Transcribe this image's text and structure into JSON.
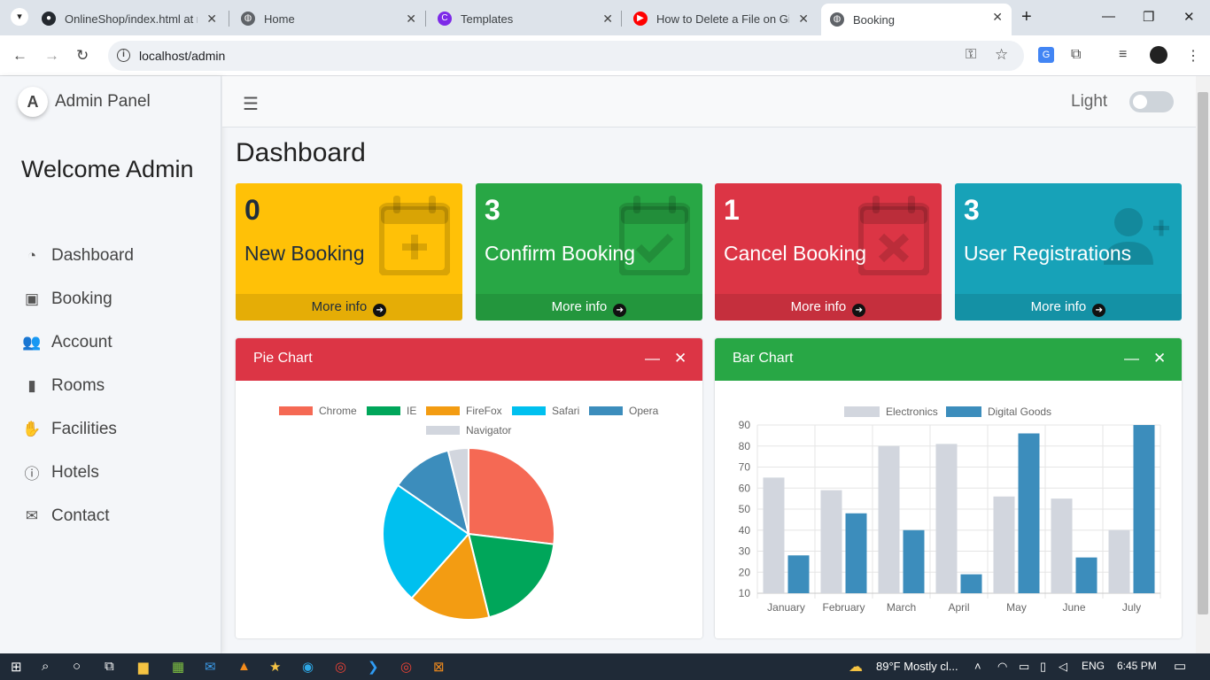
{
  "browser": {
    "tabs": [
      {
        "label": "OnlineShop/index.html at m",
        "icon": "github-icon",
        "color": "#24292f"
      },
      {
        "label": "Home",
        "icon": "globe-icon",
        "color": "#5f6368"
      },
      {
        "label": "Templates",
        "icon": "canva-icon",
        "color": "#7d2ae8"
      },
      {
        "label": "How to Delete a File on GitH",
        "icon": "youtube-icon",
        "color": "#ff0000"
      },
      {
        "label": "Booking",
        "icon": "globe-icon",
        "color": "#5f6368",
        "active": true
      }
    ],
    "url": "localhost/admin"
  },
  "sidebar": {
    "brand": "Admin Panel",
    "logo_letter": "A",
    "welcome": "Welcome Admin",
    "items": [
      {
        "label": "Dashboard",
        "icon": "tachometer-icon"
      },
      {
        "label": "Booking",
        "icon": "calendar-check-icon"
      },
      {
        "label": "Account",
        "icon": "users-icon"
      },
      {
        "label": "Rooms",
        "icon": "door-icon"
      },
      {
        "label": "Facilities",
        "icon": "handshake-icon"
      },
      {
        "label": "Hotels",
        "icon": "info-icon"
      },
      {
        "label": "Contact",
        "icon": "envelope-open-icon"
      }
    ]
  },
  "topbar": {
    "theme_label": "Light"
  },
  "page": {
    "title": "Dashboard"
  },
  "stats": [
    {
      "value": "0",
      "label": "New Booking",
      "more": "More info",
      "color": "#ffc107",
      "text_color": "#1f2d3d",
      "icon": "calendar-plus-icon"
    },
    {
      "value": "3",
      "label": "Confirm Booking",
      "more": "More info",
      "color": "#28a745",
      "text_color": "#ffffff",
      "icon": "calendar-check-icon"
    },
    {
      "value": "1",
      "label": "Cancel Booking",
      "more": "More info",
      "color": "#dc3545",
      "text_color": "#ffffff",
      "icon": "calendar-times-icon"
    },
    {
      "value": "3",
      "label": "User Registrations",
      "more": "More info",
      "color": "#17a2b8",
      "text_color": "#ffffff",
      "icon": "user-plus-icon"
    }
  ],
  "pie_card": {
    "title": "Pie Chart",
    "color": "#dc3545"
  },
  "bar_card": {
    "title": "Bar Chart",
    "color": "#28a745"
  },
  "chart_data": [
    {
      "type": "pie",
      "title": "",
      "categories": [
        "Chrome",
        "IE",
        "FireFox",
        "Safari",
        "Opera",
        "Navigator"
      ],
      "values": [
        700,
        500,
        400,
        600,
        300,
        100
      ],
      "colors": [
        "#f56954",
        "#00a65a",
        "#f39c12",
        "#00c0ef",
        "#3c8dbc",
        "#d2d6de"
      ],
      "legend": "top"
    },
    {
      "type": "bar",
      "title": "",
      "categories": [
        "January",
        "February",
        "March",
        "April",
        "May",
        "June",
        "July"
      ],
      "series": [
        {
          "name": "Electronics",
          "values": [
            65,
            59,
            80,
            81,
            56,
            55,
            40
          ],
          "color": "#d2d6de"
        },
        {
          "name": "Digital Goods",
          "values": [
            28,
            48,
            40,
            19,
            86,
            27,
            90
          ],
          "color": "#3c8dbc"
        }
      ],
      "ylim": [
        10,
        90
      ],
      "yticks": [
        10,
        20,
        30,
        40,
        50,
        60,
        70,
        80,
        90
      ],
      "grid": true,
      "legend": "top"
    }
  ],
  "taskbar": {
    "weather": "89°F  Mostly cl...",
    "lang": "ENG",
    "time": "6:45 PM"
  }
}
